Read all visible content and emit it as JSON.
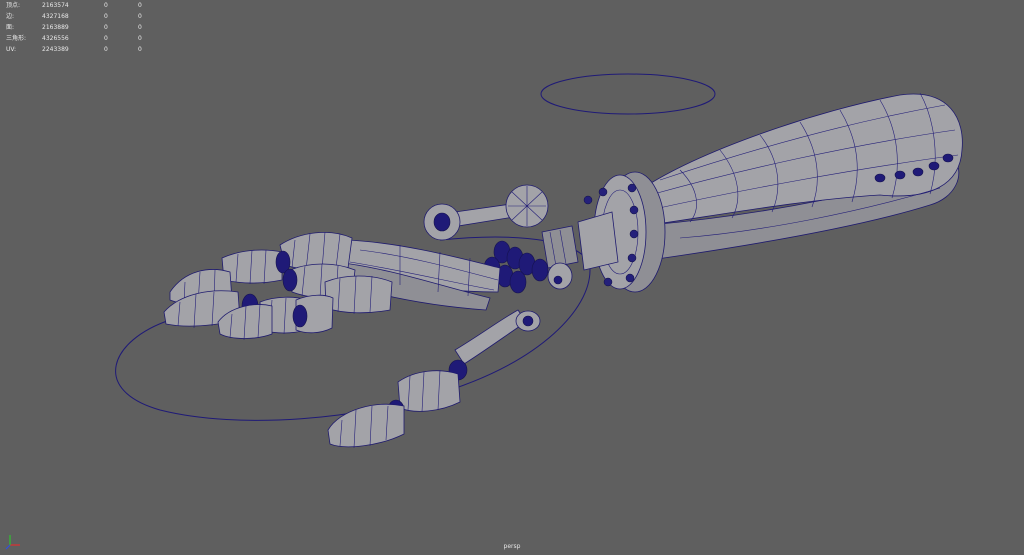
{
  "hud": {
    "rows": [
      {
        "label": "顶点:",
        "v1": "2163574",
        "v2": "0",
        "v3": "0"
      },
      {
        "label": "边:",
        "v1": "4327168",
        "v2": "0",
        "v3": "0"
      },
      {
        "label": "面:",
        "v1": "2163889",
        "v2": "0",
        "v3": "0"
      },
      {
        "label": "三角形:",
        "v1": "4326556",
        "v2": "0",
        "v3": "0"
      },
      {
        "label": "UV:",
        "v1": "2243389",
        "v2": "0",
        "v3": "0"
      }
    ]
  },
  "viewport": {
    "camera": "persp",
    "background": "#5f5f5f",
    "wire_color": "#241f78"
  },
  "axis_icon": "xyz-axis-gizmo-icon"
}
